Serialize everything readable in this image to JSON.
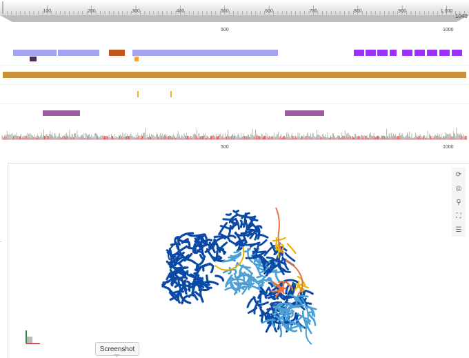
{
  "ruler": {
    "ticks": [
      "100",
      "200",
      "300",
      "400",
      "500",
      "600",
      "700",
      "800",
      "900",
      "1,000"
    ],
    "end_label": "1040"
  },
  "sequence_axis": {
    "upper_labels": [
      "500",
      "1000"
    ],
    "lower_labels": [
      "500",
      "1000"
    ]
  },
  "tracks": {
    "domains_color": "#a3a3f2",
    "region_color": "#c4541e",
    "motif_dark_color": "#4d3460",
    "site_color": "#f4a534",
    "chain_color": "#c8913a",
    "repeat_color": "#9b30ff",
    "coiled_color": "#9a5ea0",
    "variant_red": "#e02020",
    "variant_grey": "#999999"
  },
  "structure": {
    "colors": {
      "very_high": "#0a4aa6",
      "confident": "#4a9fd4",
      "low": "#e6b400",
      "very_low": "#e8733c"
    }
  },
  "toolbar": {
    "icons": [
      "reset-icon",
      "center-icon",
      "key-icon",
      "expand-icon",
      "settings-icon"
    ],
    "glyphs": [
      "⟳",
      "◎",
      "⚲",
      "⛶",
      "☰"
    ]
  },
  "screenshot_button": {
    "label": "Screenshot"
  }
}
